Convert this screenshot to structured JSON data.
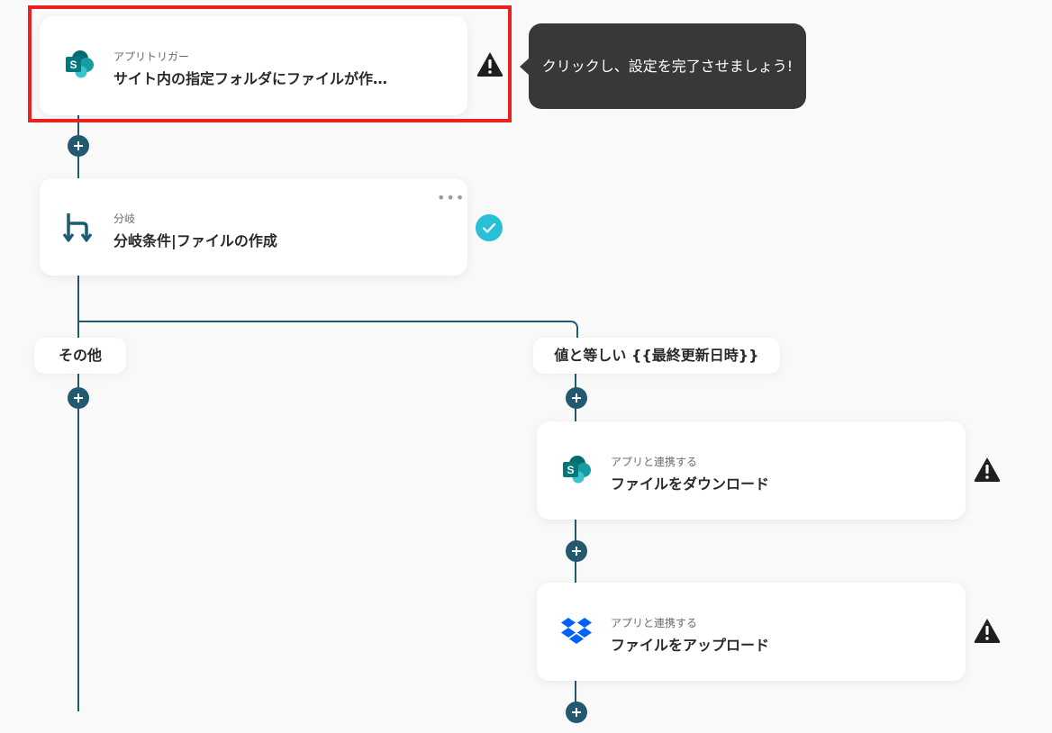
{
  "trigger": {
    "sublabel": "アプリトリガー",
    "title": "サイト内の指定フォルダにファイルが作…",
    "icon": "sharepoint-icon"
  },
  "tooltip": {
    "text": "クリックし、設定を完了させましょう!"
  },
  "branch": {
    "sublabel": "分岐",
    "title": "分岐条件|ファイルの作成",
    "icon": "branch-icon",
    "status_icon": "check-circle-icon",
    "menu_icon": "more-horizontal-icon"
  },
  "branch_labels": {
    "other": "その他",
    "equals": "値と等しい {{最終更新日時}}"
  },
  "steps": [
    {
      "sublabel": "アプリと連携する",
      "title": "ファイルをダウンロード",
      "icon": "sharepoint-icon",
      "status_icon": "warning-icon"
    },
    {
      "sublabel": "アプリと連携する",
      "title": "ファイルをアップロード",
      "icon": "dropbox-icon",
      "status_icon": "warning-icon"
    }
  ],
  "colors": {
    "connector": "#23596e",
    "highlight": "#e8221f",
    "tooltip_bg": "#383838",
    "check": "#27c0d6",
    "sharepoint": "#038387",
    "dropbox": "#0061fe"
  }
}
